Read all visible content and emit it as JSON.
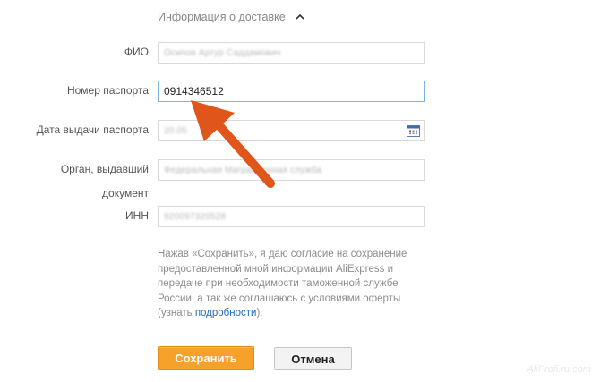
{
  "section": {
    "title": "Информация о доставке",
    "caret_icon": "chevron-up-icon"
  },
  "form": {
    "fio": {
      "label": "ФИО",
      "value": "Осипов Артур Саддамович"
    },
    "passport_number": {
      "label": "Номер паспорта",
      "value": "0914346512"
    },
    "passport_date": {
      "label": "Дата выдачи паспорта",
      "value": "20.05",
      "icon": "calendar-icon"
    },
    "issuer": {
      "label_line1": "Орган, выдавший",
      "label_line2": "документ",
      "value": "Федеральная Миграционная служба"
    },
    "inn": {
      "label": "ИНН",
      "value": "920097320528"
    }
  },
  "consent": {
    "text": "Нажав «Сохранить», я даю согласие на сохранение предоставленной мной информации AliExpress и передаче при необходимости таможенной службе России, а так же соглашаюсь с условиями оферты (узнать ",
    "link": "подробности",
    "tail": ")."
  },
  "buttons": {
    "save": "Сохранить",
    "cancel": "Отмена"
  },
  "watermark": "AliProfi.ru.com",
  "colors": {
    "accent": "#f5a12a",
    "arrow": "#e0561a",
    "link": "#1f6bb5",
    "focus_border": "#7ab5e6"
  }
}
